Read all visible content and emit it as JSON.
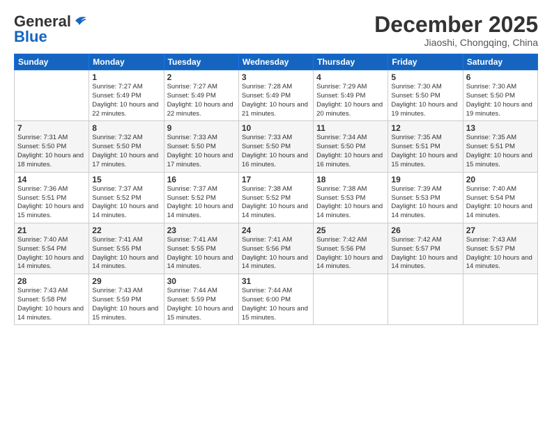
{
  "logo": {
    "line1": "General",
    "line2": "Blue"
  },
  "title": "December 2025",
  "subtitle": "Jiaoshi, Chongqing, China",
  "days_header": [
    "Sunday",
    "Monday",
    "Tuesday",
    "Wednesday",
    "Thursday",
    "Friday",
    "Saturday"
  ],
  "weeks": [
    [
      {
        "day": "",
        "info": ""
      },
      {
        "day": "1",
        "info": "Sunrise: 7:27 AM\nSunset: 5:49 PM\nDaylight: 10 hours\nand 22 minutes."
      },
      {
        "day": "2",
        "info": "Sunrise: 7:27 AM\nSunset: 5:49 PM\nDaylight: 10 hours\nand 22 minutes."
      },
      {
        "day": "3",
        "info": "Sunrise: 7:28 AM\nSunset: 5:49 PM\nDaylight: 10 hours\nand 21 minutes."
      },
      {
        "day": "4",
        "info": "Sunrise: 7:29 AM\nSunset: 5:49 PM\nDaylight: 10 hours\nand 20 minutes."
      },
      {
        "day": "5",
        "info": "Sunrise: 7:30 AM\nSunset: 5:50 PM\nDaylight: 10 hours\nand 19 minutes."
      },
      {
        "day": "6",
        "info": "Sunrise: 7:30 AM\nSunset: 5:50 PM\nDaylight: 10 hours\nand 19 minutes."
      }
    ],
    [
      {
        "day": "7",
        "info": "Sunrise: 7:31 AM\nSunset: 5:50 PM\nDaylight: 10 hours\nand 18 minutes."
      },
      {
        "day": "8",
        "info": "Sunrise: 7:32 AM\nSunset: 5:50 PM\nDaylight: 10 hours\nand 17 minutes."
      },
      {
        "day": "9",
        "info": "Sunrise: 7:33 AM\nSunset: 5:50 PM\nDaylight: 10 hours\nand 17 minutes."
      },
      {
        "day": "10",
        "info": "Sunrise: 7:33 AM\nSunset: 5:50 PM\nDaylight: 10 hours\nand 16 minutes."
      },
      {
        "day": "11",
        "info": "Sunrise: 7:34 AM\nSunset: 5:50 PM\nDaylight: 10 hours\nand 16 minutes."
      },
      {
        "day": "12",
        "info": "Sunrise: 7:35 AM\nSunset: 5:51 PM\nDaylight: 10 hours\nand 15 minutes."
      },
      {
        "day": "13",
        "info": "Sunrise: 7:35 AM\nSunset: 5:51 PM\nDaylight: 10 hours\nand 15 minutes."
      }
    ],
    [
      {
        "day": "14",
        "info": "Sunrise: 7:36 AM\nSunset: 5:51 PM\nDaylight: 10 hours\nand 15 minutes."
      },
      {
        "day": "15",
        "info": "Sunrise: 7:37 AM\nSunset: 5:52 PM\nDaylight: 10 hours\nand 14 minutes."
      },
      {
        "day": "16",
        "info": "Sunrise: 7:37 AM\nSunset: 5:52 PM\nDaylight: 10 hours\nand 14 minutes."
      },
      {
        "day": "17",
        "info": "Sunrise: 7:38 AM\nSunset: 5:52 PM\nDaylight: 10 hours\nand 14 minutes."
      },
      {
        "day": "18",
        "info": "Sunrise: 7:38 AM\nSunset: 5:53 PM\nDaylight: 10 hours\nand 14 minutes."
      },
      {
        "day": "19",
        "info": "Sunrise: 7:39 AM\nSunset: 5:53 PM\nDaylight: 10 hours\nand 14 minutes."
      },
      {
        "day": "20",
        "info": "Sunrise: 7:40 AM\nSunset: 5:54 PM\nDaylight: 10 hours\nand 14 minutes."
      }
    ],
    [
      {
        "day": "21",
        "info": "Sunrise: 7:40 AM\nSunset: 5:54 PM\nDaylight: 10 hours\nand 14 minutes."
      },
      {
        "day": "22",
        "info": "Sunrise: 7:41 AM\nSunset: 5:55 PM\nDaylight: 10 hours\nand 14 minutes."
      },
      {
        "day": "23",
        "info": "Sunrise: 7:41 AM\nSunset: 5:55 PM\nDaylight: 10 hours\nand 14 minutes."
      },
      {
        "day": "24",
        "info": "Sunrise: 7:41 AM\nSunset: 5:56 PM\nDaylight: 10 hours\nand 14 minutes."
      },
      {
        "day": "25",
        "info": "Sunrise: 7:42 AM\nSunset: 5:56 PM\nDaylight: 10 hours\nand 14 minutes."
      },
      {
        "day": "26",
        "info": "Sunrise: 7:42 AM\nSunset: 5:57 PM\nDaylight: 10 hours\nand 14 minutes."
      },
      {
        "day": "27",
        "info": "Sunrise: 7:43 AM\nSunset: 5:57 PM\nDaylight: 10 hours\nand 14 minutes."
      }
    ],
    [
      {
        "day": "28",
        "info": "Sunrise: 7:43 AM\nSunset: 5:58 PM\nDaylight: 10 hours\nand 14 minutes."
      },
      {
        "day": "29",
        "info": "Sunrise: 7:43 AM\nSunset: 5:59 PM\nDaylight: 10 hours\nand 15 minutes."
      },
      {
        "day": "30",
        "info": "Sunrise: 7:44 AM\nSunset: 5:59 PM\nDaylight: 10 hours\nand 15 minutes."
      },
      {
        "day": "31",
        "info": "Sunrise: 7:44 AM\nSunset: 6:00 PM\nDaylight: 10 hours\nand 15 minutes."
      },
      {
        "day": "",
        "info": ""
      },
      {
        "day": "",
        "info": ""
      },
      {
        "day": "",
        "info": ""
      }
    ]
  ]
}
